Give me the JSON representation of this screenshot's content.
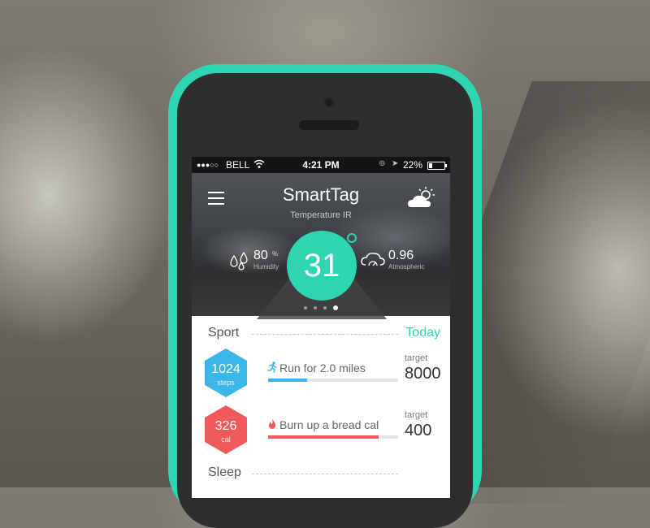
{
  "status_bar": {
    "signal": "●●●○○",
    "carrier": "BELL",
    "wifi_icon": "wifi-icon",
    "time": "4:21 PM",
    "battery": "22%"
  },
  "header": {
    "title": "SmartTag",
    "subtitle": "Temperature IR",
    "menu_icon": "hamburger-menu-icon",
    "weather_icon": "partly-cloudy-icon"
  },
  "temperature": {
    "value": "31",
    "degree_symbol": "o"
  },
  "humidity": {
    "value": "80",
    "unit": "%",
    "label": "Humidity"
  },
  "pressure": {
    "value": "0.96",
    "label": "Atmospheric"
  },
  "pager": {
    "count": 4,
    "active_index": 3
  },
  "sport": {
    "label": "Sport",
    "today": "Today",
    "activities": [
      {
        "value": "1024",
        "unit": "steps",
        "icon": "running-icon",
        "label": "Run for 2.0 miles",
        "target_label": "target",
        "target": "8000",
        "progress": 0.3,
        "color": "#3cb5e8"
      },
      {
        "value": "326",
        "unit": "cal",
        "icon": "flame-icon",
        "label": "Burn up a bread cal",
        "target_label": "target",
        "target": "400",
        "progress": 0.85,
        "color": "#f05a5b"
      }
    ]
  },
  "sleep": {
    "label": "Sleep"
  },
  "colors": {
    "accent": "#2fd5b3",
    "steps": "#3cb5e8",
    "calories": "#f05a5b"
  }
}
